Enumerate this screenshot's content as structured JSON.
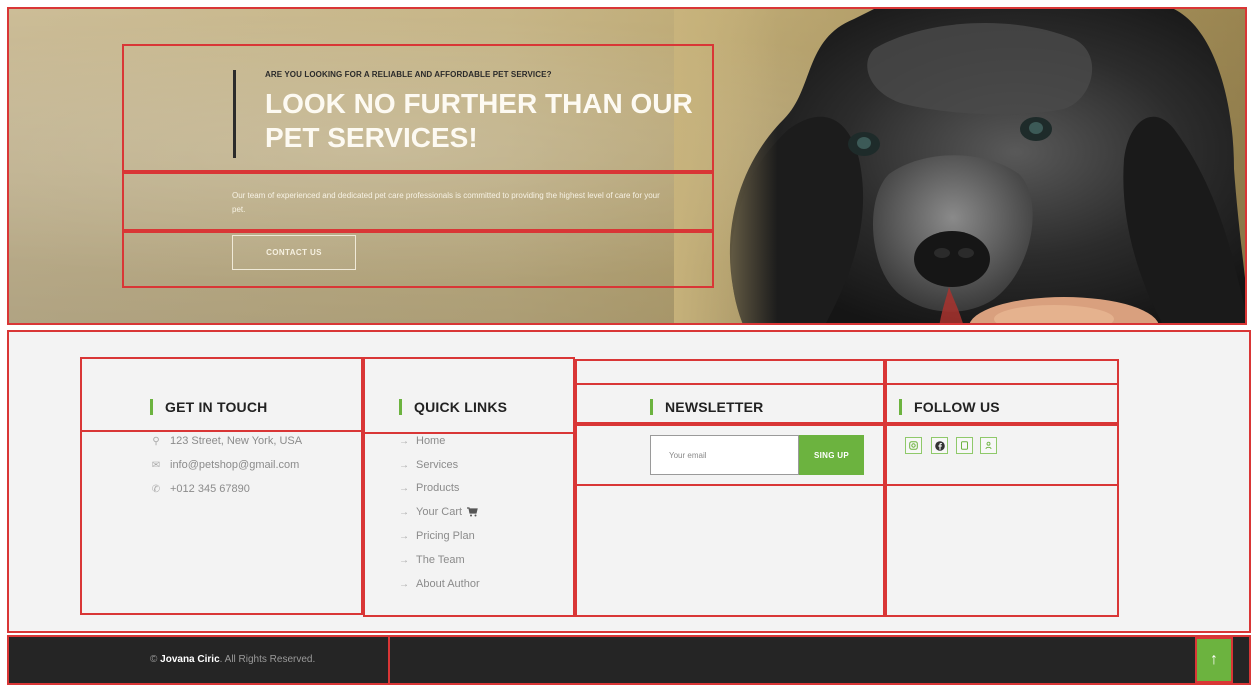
{
  "hero": {
    "eyebrow": "ARE YOU LOOKING FOR A RELIABLE AND AFFORDABLE PET SERVICE?",
    "title": "LOOK NO FURTHER THAN OUR PET SERVICES!",
    "text": "Our team of experienced and dedicated pet care professionals is committed to providing the highest level of care for your pet.",
    "button_label": "CONTACT US"
  },
  "footer": {
    "get_in_touch": {
      "title": "GET IN TOUCH",
      "address": "123 Street, New York, USA",
      "email": "info@petshop@gmail.com",
      "phone": "+012 345 67890"
    },
    "quick_links": {
      "title": "QUICK LINKS",
      "items": [
        "Home",
        "Services",
        "Products",
        "Your Cart",
        "Pricing Plan",
        "The Team",
        "About Author"
      ]
    },
    "newsletter": {
      "title": "NEWSLETTER",
      "placeholder": "Your email",
      "button_label": "SING UP"
    },
    "follow_us": {
      "title": "FOLLOW US",
      "icons": [
        "instagram-icon",
        "facebook-icon",
        "tiktok-icon",
        "user-icon"
      ]
    }
  },
  "bottom_bar": {
    "author": "Jovana Ciric",
    "rights": ". All Rights Reserved.",
    "back_to_top_icon": "arrow-up-icon"
  },
  "colors": {
    "accent_green": "#6cb33f",
    "annotation_red": "#d93636",
    "bottom_bar": "#252525"
  }
}
